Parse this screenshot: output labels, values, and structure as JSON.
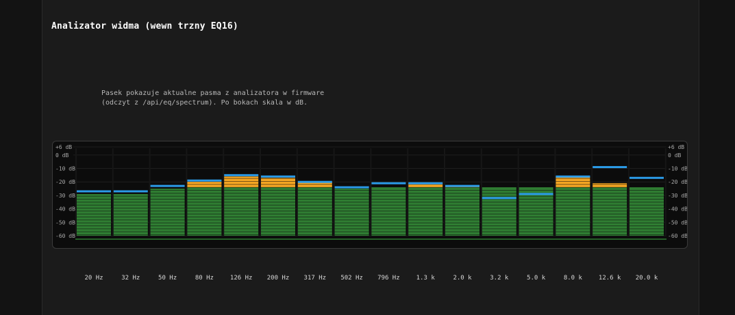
{
  "title": "Analizator widma (wewn trzny EQ16)",
  "description": {
    "line1": "Pasek pokazuje aktualne pasma z analizatora w firmware",
    "line2": "(odczyt z /api/eq/spectrum). Po bokach skala w dB."
  },
  "colors": {
    "background": "#131313",
    "panel": "#1b1b1b",
    "green": "#2f7d32",
    "orange": "#f5a623",
    "peak_blue": "#2b9be8"
  },
  "scale_labels": [
    "+6 dB",
    "0 dB",
    "-10 dB",
    "-20 dB",
    "-30 dB",
    "-40 dB",
    "-50 dB",
    "-60 dB"
  ],
  "scale_values": [
    6,
    0,
    -10,
    -20,
    -30,
    -40,
    -50,
    -60
  ],
  "bands": [
    {
      "label": "20 Hz",
      "level": -29,
      "peak": -27
    },
    {
      "label": "32 Hz",
      "level": -29,
      "peak": -27
    },
    {
      "label": "50 Hz",
      "level": -25,
      "peak": -23
    },
    {
      "label": "80 Hz",
      "level": -20,
      "peak": -19
    },
    {
      "label": "126 Hz",
      "level": -16,
      "peak": -15
    },
    {
      "label": "200 Hz",
      "level": -17,
      "peak": -16
    },
    {
      "label": "317 Hz",
      "level": -20,
      "peak": -20
    },
    {
      "label": "502 Hz",
      "level": -25,
      "peak": -24
    },
    {
      "label": "796 Hz",
      "level": -24,
      "peak": -21
    },
    {
      "label": "1.3 k",
      "level": -21,
      "peak": -21
    },
    {
      "label": "2.0 k",
      "level": -23,
      "peak": -23
    },
    {
      "label": "3.2 k",
      "level": -24,
      "peak": -32
    },
    {
      "label": "5.0 k",
      "level": -24,
      "peak": -29
    },
    {
      "label": "8.0 k",
      "level": -16,
      "peak": -16
    },
    {
      "label": "12.6 k",
      "level": -21,
      "peak": -9
    },
    {
      "label": "20.0 k",
      "level": -24,
      "peak": -17
    }
  ]
}
